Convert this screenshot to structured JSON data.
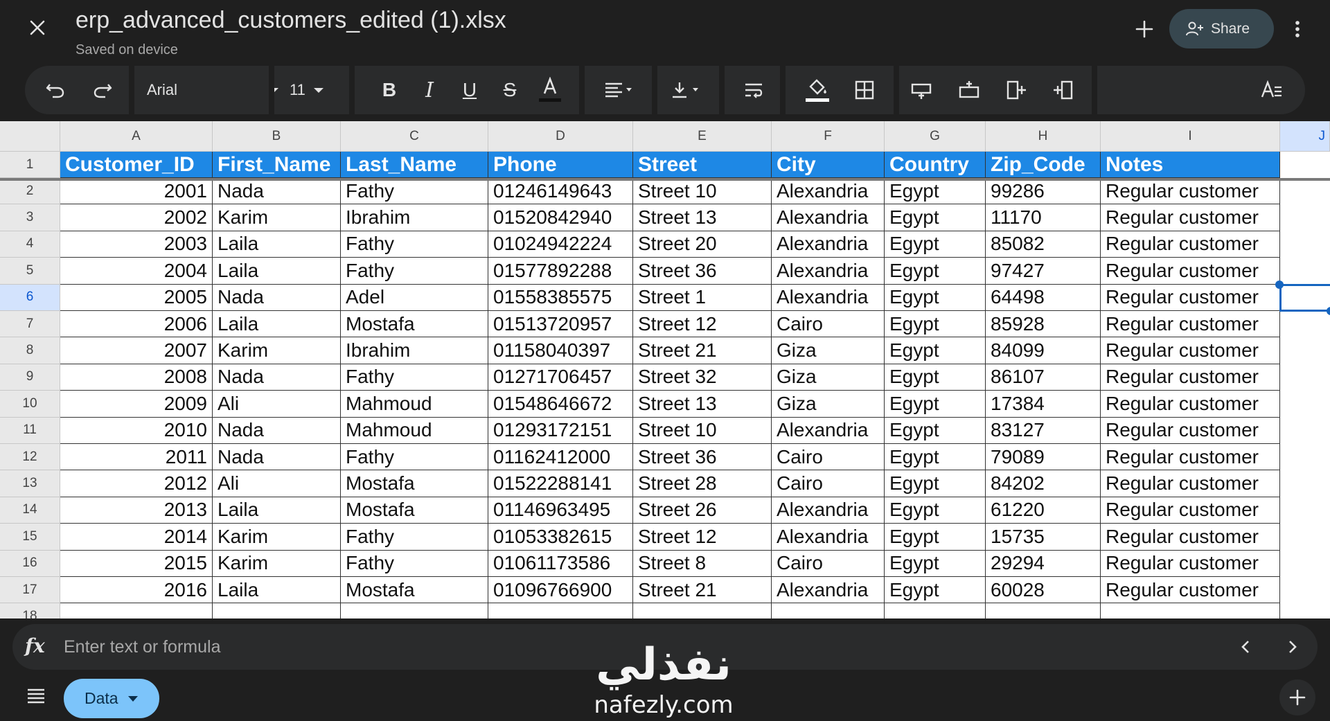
{
  "title_bar": {
    "file_name": "erp_advanced_customers_edited (1).xlsx",
    "subtitle": "Saved on device",
    "share_label": "Share"
  },
  "toolbar": {
    "font": "Arial",
    "font_size": "11",
    "icons": [
      "undo-icon",
      "redo-icon",
      "bold-icon",
      "italic-icon",
      "underline-icon",
      "strikethrough-icon",
      "text-color-icon",
      "horizontal-align-icon",
      "vertical-align-icon",
      "text-wrap-icon",
      "fill-color-icon",
      "borders-icon",
      "insert-row-above-icon",
      "insert-row-below-icon",
      "insert-column-left-icon",
      "insert-column-right-icon",
      "format-text-icon"
    ]
  },
  "sheet": {
    "column_letters": [
      "A",
      "B",
      "C",
      "D",
      "E",
      "F",
      "G",
      "H",
      "I",
      "J"
    ],
    "row_numbers": [
      "1",
      "2",
      "3",
      "4",
      "5",
      "6",
      "7",
      "8",
      "9",
      "10",
      "11",
      "12",
      "13",
      "14",
      "15",
      "16",
      "17",
      "18"
    ],
    "header_row": [
      "Customer_ID",
      "First_Name",
      "Last_Name",
      "Phone",
      "Street",
      "City",
      "Country",
      "Zip_Code",
      "Notes"
    ],
    "rows": [
      [
        "2001",
        "Nada",
        "Fathy",
        "01246149643",
        "Street 10",
        "Alexandria",
        "Egypt",
        "99286",
        "Regular customer"
      ],
      [
        "2002",
        "Karim",
        "Ibrahim",
        "01520842940",
        "Street 13",
        "Alexandria",
        "Egypt",
        "11170",
        "Regular customer"
      ],
      [
        "2003",
        "Laila",
        "Fathy",
        "01024942224",
        "Street 20",
        "Alexandria",
        "Egypt",
        "85082",
        "Regular customer"
      ],
      [
        "2004",
        "Laila",
        "Fathy",
        "01577892288",
        "Street 36",
        "Alexandria",
        "Egypt",
        "97427",
        "Regular customer"
      ],
      [
        "2005",
        "Nada",
        "Adel",
        "01558385575",
        "Street 1",
        "Alexandria",
        "Egypt",
        "64498",
        "Regular customer"
      ],
      [
        "2006",
        "Laila",
        "Mostafa",
        "01513720957",
        "Street 12",
        "Cairo",
        "Egypt",
        "85928",
        "Regular customer"
      ],
      [
        "2007",
        "Karim",
        "Ibrahim",
        "01158040397",
        "Street 21",
        "Giza",
        "Egypt",
        "84099",
        "Regular customer"
      ],
      [
        "2008",
        "Nada",
        "Fathy",
        "01271706457",
        "Street 32",
        "Giza",
        "Egypt",
        "86107",
        "Regular customer"
      ],
      [
        "2009",
        "Ali",
        "Mahmoud",
        "01548646672",
        "Street 13",
        "Giza",
        "Egypt",
        "17384",
        "Regular customer"
      ],
      [
        "2010",
        "Nada",
        "Mahmoud",
        "01293172151",
        "Street 10",
        "Alexandria",
        "Egypt",
        "83127",
        "Regular customer"
      ],
      [
        "2011",
        "Nada",
        "Fathy",
        "01162412000",
        "Street 36",
        "Cairo",
        "Egypt",
        "79089",
        "Regular customer"
      ],
      [
        "2012",
        "Ali",
        "Mostafa",
        "01522288141",
        "Street 28",
        "Cairo",
        "Egypt",
        "84202",
        "Regular customer"
      ],
      [
        "2013",
        "Laila",
        "Mostafa",
        "01146963495",
        "Street 26",
        "Alexandria",
        "Egypt",
        "61220",
        "Regular customer"
      ],
      [
        "2014",
        "Karim",
        "Fathy",
        "01053382615",
        "Street 12",
        "Alexandria",
        "Egypt",
        "15735",
        "Regular customer"
      ],
      [
        "2015",
        "Karim",
        "Fathy",
        "01061173586",
        "Street 8",
        "Cairo",
        "Egypt",
        "29294",
        "Regular customer"
      ],
      [
        "2016",
        "Laila",
        "Mostafa",
        "01096766900",
        "Street 21",
        "Alexandria",
        "Egypt",
        "60028",
        "Regular customer"
      ]
    ],
    "selected_cell": "J6",
    "header_color": "#1e88e5",
    "selection_color": "#1565c0"
  },
  "formula_bar": {
    "fx_label": "fx",
    "placeholder": "Enter text or formula"
  },
  "bottom_bar": {
    "sheet_tab_label": "Data"
  },
  "watermark": {
    "arabic": "نفذلي",
    "latin": "nafezly.com"
  }
}
